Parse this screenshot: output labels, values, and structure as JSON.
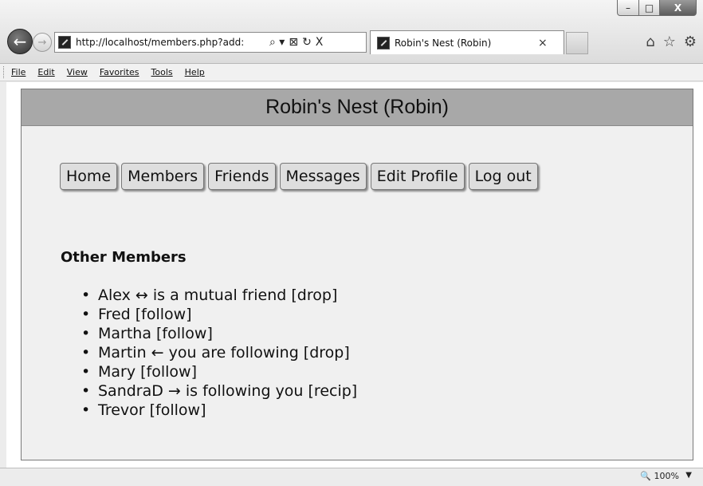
{
  "browser": {
    "url": "http://localhost/members.php?add:",
    "tab_title": "Robin's Nest (Robin)",
    "tab_close": "×",
    "window_controls": {
      "minimize": "–",
      "maximize": "□",
      "close": "X"
    },
    "back_icon": "←",
    "forward_icon": "→",
    "address_icons": {
      "search": "⌕ ▾",
      "compat": "⊠",
      "refresh": "↻",
      "stop": "X"
    },
    "right_icons": {
      "home": "⌂",
      "favorites": "☆",
      "tools": "⚙"
    },
    "zoom": "🔍 100%",
    "zoom_arrow": "▼"
  },
  "menubar": {
    "items": [
      "File",
      "Edit",
      "View",
      "Favorites",
      "Tools",
      "Help"
    ]
  },
  "site": {
    "title": "Robin's Nest (Robin)",
    "nav": [
      "Home",
      "Members",
      "Friends",
      "Messages",
      "Edit Profile",
      "Log out"
    ],
    "members_heading": "Other Members",
    "members": [
      "Alex ↔ is a mutual friend [drop]",
      "Fred [follow]",
      "Martha [follow]",
      "Martin ← you are following [drop]",
      "Mary [follow]",
      "SandraD → is following you [recip]",
      "Trevor [follow]"
    ]
  },
  "colors": {
    "header_bg": "#a8a8a8",
    "page_bg": "#f0f0f0",
    "button_bg": "#dedede"
  }
}
